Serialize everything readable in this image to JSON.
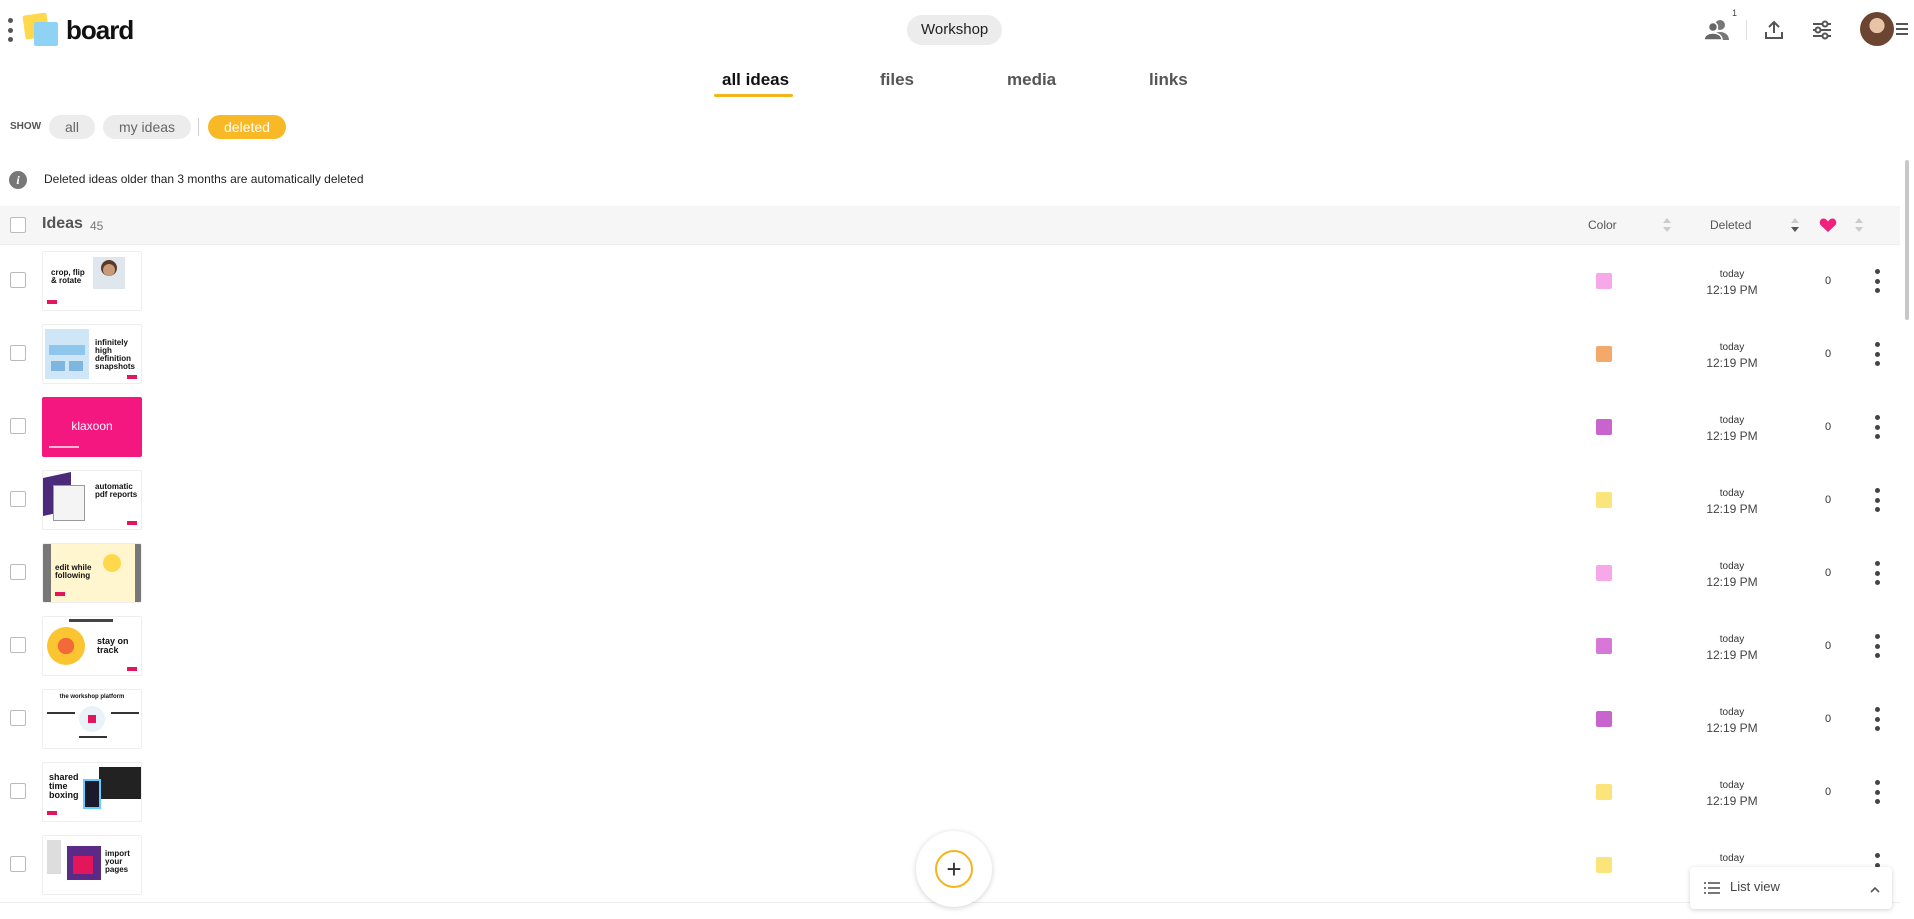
{
  "header": {
    "brand": "board",
    "board_name": "Workshop",
    "participants_count": "1"
  },
  "tabs": [
    {
      "label": "all ideas",
      "active": true
    },
    {
      "label": "files",
      "active": false
    },
    {
      "label": "media",
      "active": false
    },
    {
      "label": "links",
      "active": false
    }
  ],
  "filter": {
    "show_label": "SHOW",
    "options": [
      {
        "label": "all",
        "active": false
      },
      {
        "label": "my ideas",
        "active": false
      },
      {
        "label": "deleted",
        "active": true
      }
    ]
  },
  "info": {
    "text": "Deleted ideas older than 3 months are automatically deleted"
  },
  "table": {
    "title": "Ideas",
    "count": "45",
    "col_color": "Color",
    "col_deleted": "Deleted"
  },
  "rows": [
    {
      "thumb_label": "crop, flip & rotate",
      "thumb_style": "photo",
      "color": "#f7a8ea",
      "deleted_day": "today",
      "deleted_time": "12:19 PM",
      "likes": "0"
    },
    {
      "thumb_label": "infinitely high definition snapshots",
      "thumb_style": "blue",
      "color": "#f4a86a",
      "deleted_day": "today",
      "deleted_time": "12:19 PM",
      "likes": "0"
    },
    {
      "thumb_label": "klaxoon",
      "thumb_style": "pink",
      "color": "#c964cf",
      "deleted_day": "today",
      "deleted_time": "12:19 PM",
      "likes": "0"
    },
    {
      "thumb_label": "automatic pdf reports",
      "thumb_style": "purple",
      "color": "#fbe57a",
      "deleted_day": "today",
      "deleted_time": "12:19 PM",
      "likes": "0"
    },
    {
      "thumb_label": "edit while following",
      "thumb_style": "yellow",
      "color": "#f7a8ea",
      "deleted_day": "today",
      "deleted_time": "12:19 PM",
      "likes": "0"
    },
    {
      "thumb_label": "stay on track",
      "thumb_style": "sun",
      "color": "#d777d8",
      "deleted_day": "today",
      "deleted_time": "12:19 PM",
      "likes": "0"
    },
    {
      "thumb_label": "the workshop platform",
      "thumb_style": "diagram",
      "color": "#c964cf",
      "deleted_day": "today",
      "deleted_time": "12:19 PM",
      "likes": "0"
    },
    {
      "thumb_label": "shared time boxing",
      "thumb_style": "devices",
      "color": "#fbe57a",
      "deleted_day": "today",
      "deleted_time": "12:19 PM",
      "likes": "0"
    },
    {
      "thumb_label": "import your pages",
      "thumb_style": "pages",
      "color": "#fbe57a",
      "deleted_day": "today",
      "deleted_time": "",
      "likes": ""
    }
  ],
  "add_button": {
    "symbol": "+"
  },
  "view_selector": {
    "label": "List view"
  }
}
